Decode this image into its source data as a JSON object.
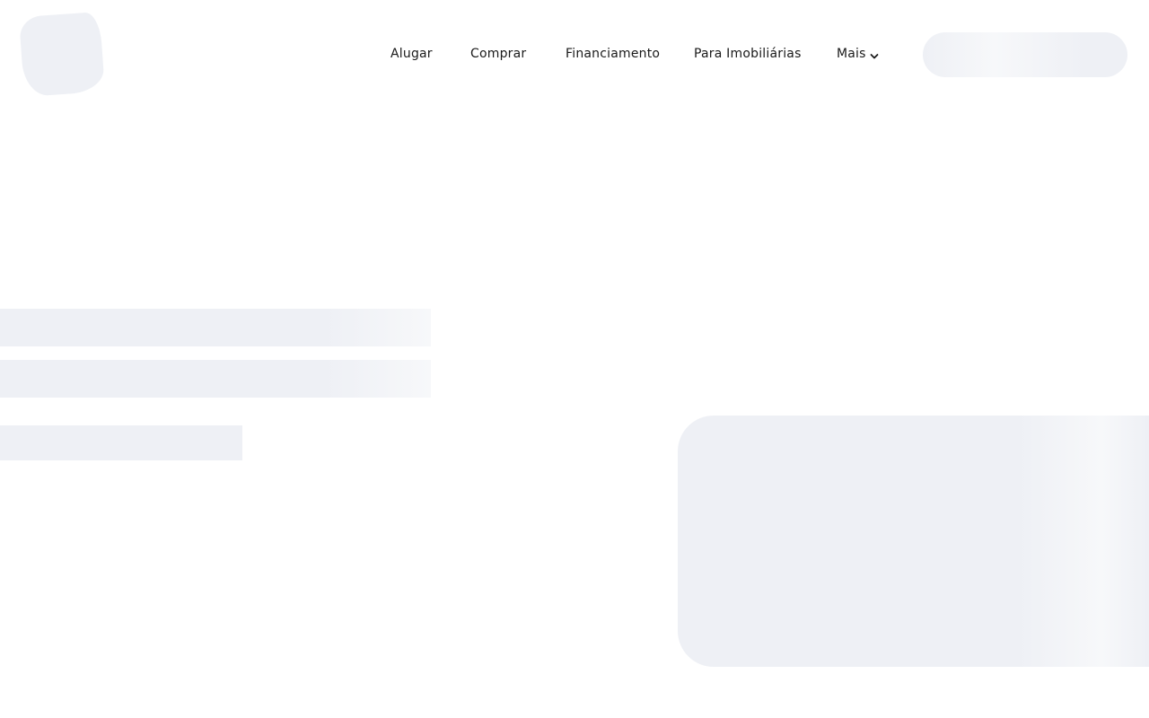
{
  "nav": {
    "items": [
      {
        "label": "Alugar"
      },
      {
        "label": "Comprar"
      },
      {
        "label": "Financiamento"
      },
      {
        "label": "Para Imobiliárias"
      },
      {
        "label": "Mais",
        "icon": "chevron-down-icon"
      }
    ]
  },
  "colors": {
    "skeleton": "#eef0f5",
    "skeleton_highlight": "#f7f8fa",
    "nav_text": "#1a1a1a",
    "background": "#ffffff"
  }
}
